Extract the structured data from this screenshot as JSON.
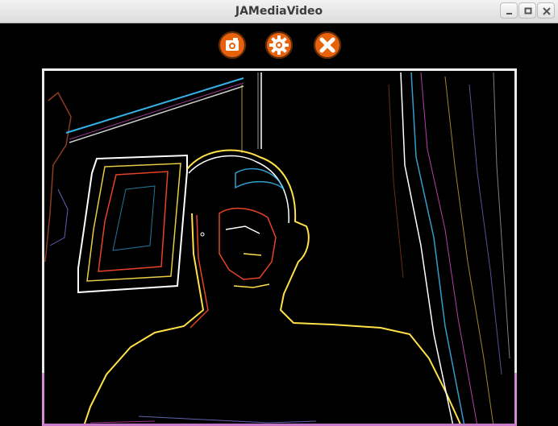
{
  "window": {
    "title": "JAMediaVideo"
  },
  "titlebar_controls": [
    {
      "name": "minimize",
      "icon": "minimize-icon"
    },
    {
      "name": "maximize",
      "icon": "maximize-icon"
    },
    {
      "name": "close",
      "icon": "close-window-icon"
    }
  ],
  "toolbar": {
    "buttons": [
      {
        "icon": "camera-icon"
      },
      {
        "icon": "gear-icon"
      },
      {
        "icon": "close-icon"
      }
    ],
    "accent_color": "#e8610c"
  },
  "video": {
    "effect_colors": [
      "#ffffff",
      "#ffe14a",
      "#ff4a2a",
      "#3cc4ff",
      "#ff5cf0",
      "#8a8aff"
    ]
  }
}
